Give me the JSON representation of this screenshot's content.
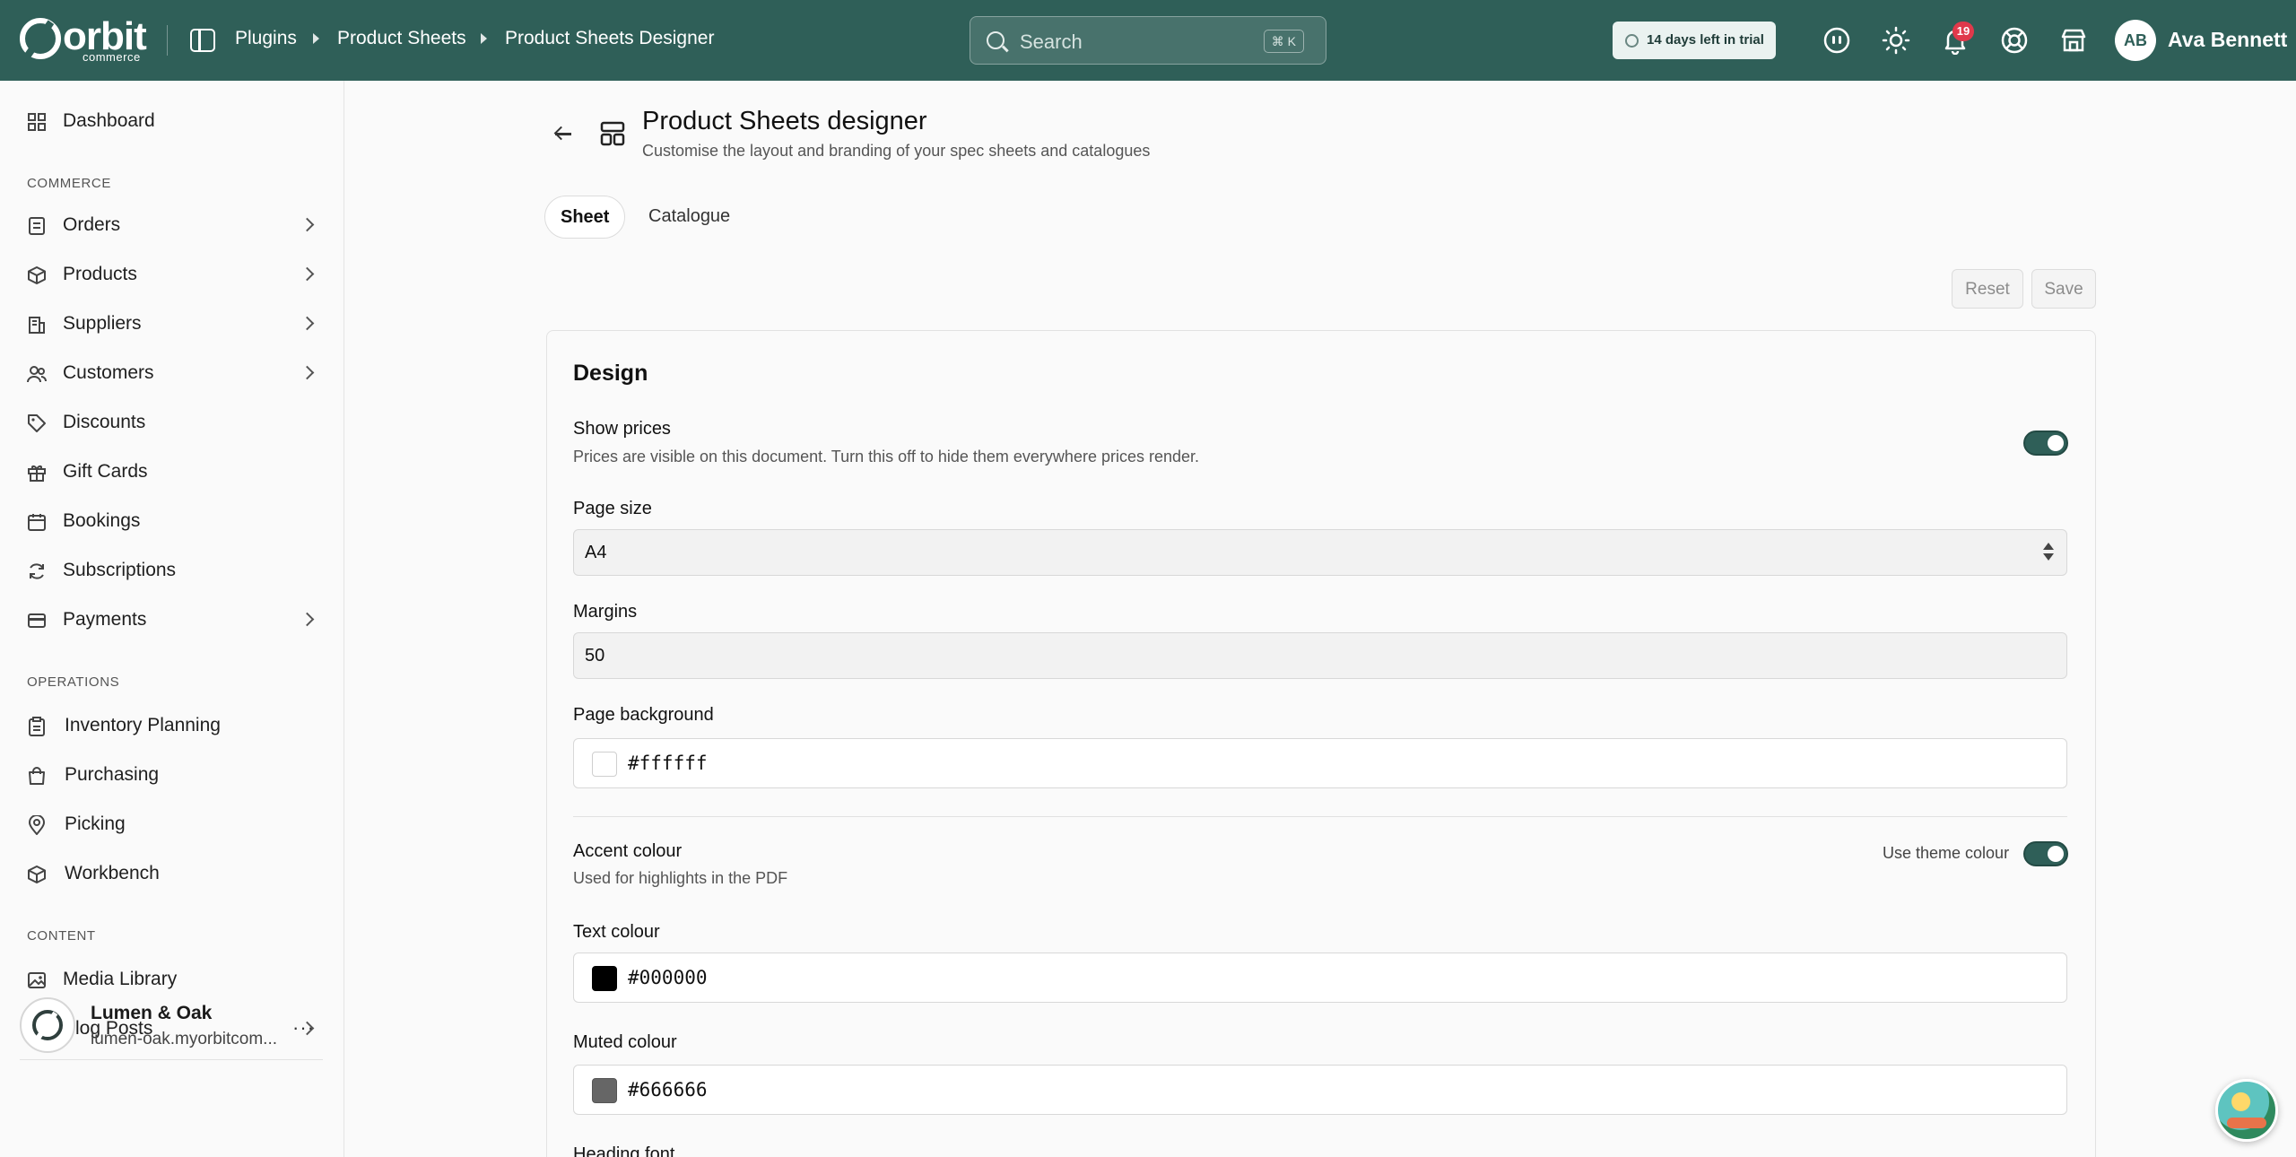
{
  "header": {
    "logo_word": "orbit",
    "logo_sub": "commerce",
    "breadcrumbs": [
      "Plugins",
      "Product Sheets",
      "Product Sheets Designer"
    ],
    "search_placeholder": "Search",
    "search_shortcut": "⌘ K",
    "trial_text": "14 days left in trial",
    "notification_count": "19",
    "user_initials": "AB",
    "user_name": "Ava Bennett",
    "icons": [
      "discord-icon",
      "sun-icon",
      "bell-icon",
      "help-lifebuoy-icon",
      "storefront-icon"
    ]
  },
  "sidebar": {
    "top_item": {
      "label": "Dashboard",
      "icon": "dashboard-icon"
    },
    "sections": [
      {
        "title": "COMMERCE",
        "items": [
          {
            "label": "Orders",
            "icon": "orders-icon",
            "has_children": true
          },
          {
            "label": "Products",
            "icon": "box-icon",
            "has_children": true
          },
          {
            "label": "Suppliers",
            "icon": "building-icon",
            "has_children": true
          },
          {
            "label": "Customers",
            "icon": "users-icon",
            "has_children": true
          },
          {
            "label": "Discounts",
            "icon": "tag-icon",
            "has_children": false
          },
          {
            "label": "Gift Cards",
            "icon": "gift-icon",
            "has_children": false
          },
          {
            "label": "Bookings",
            "icon": "calendar-icon",
            "has_children": false
          },
          {
            "label": "Subscriptions",
            "icon": "refresh-icon",
            "has_children": false
          },
          {
            "label": "Payments",
            "icon": "credit-card-icon",
            "has_children": true
          }
        ]
      },
      {
        "title": "OPERATIONS",
        "items": [
          {
            "label": "Inventory Planning",
            "icon": "clipboard-icon",
            "has_children": false
          },
          {
            "label": "Purchasing",
            "icon": "shopping-bag-icon",
            "has_children": false
          },
          {
            "label": "Picking",
            "icon": "map-pin-icon",
            "has_children": false
          },
          {
            "label": "Workbench",
            "icon": "cube-icon",
            "has_children": false
          }
        ]
      },
      {
        "title": "CONTENT",
        "items": [
          {
            "label": "Media Library",
            "icon": "image-icon",
            "has_children": false
          },
          {
            "label": "Blog Posts",
            "icon": "document-icon",
            "has_children": true
          }
        ]
      }
    ],
    "store": {
      "name": "Lumen & Oak",
      "url": "lumen-oak.myorbitcom...",
      "more": "···"
    }
  },
  "page": {
    "title": "Product Sheets designer",
    "subtitle": "Customise the layout and branding of your spec sheets and catalogues",
    "tabs": [
      {
        "label": "Sheet",
        "active": true
      },
      {
        "label": "Catalogue",
        "active": false
      }
    ],
    "reset_label": "Reset",
    "save_label": "Save"
  },
  "design": {
    "title": "Design",
    "show_prices": {
      "label": "Show prices",
      "help": "Prices are visible on this document. Turn this off to hide them everywhere prices render.",
      "enabled": true
    },
    "page_size": {
      "label": "Page size",
      "value": "A4"
    },
    "margins": {
      "label": "Margins",
      "value": "50"
    },
    "page_background": {
      "label": "Page background",
      "value": "#ffffff"
    },
    "accent_colour": {
      "label": "Accent colour",
      "help": "Used for highlights in the PDF",
      "use_theme_label": "Use theme colour",
      "use_theme": true
    },
    "text_colour": {
      "label": "Text colour",
      "value": "#000000"
    },
    "muted_colour": {
      "label": "Muted colour",
      "value": "#666666"
    },
    "heading_font": {
      "label": "Heading font"
    }
  },
  "colors": {
    "brand": "#2f5f58",
    "badge": "#e0394b"
  }
}
